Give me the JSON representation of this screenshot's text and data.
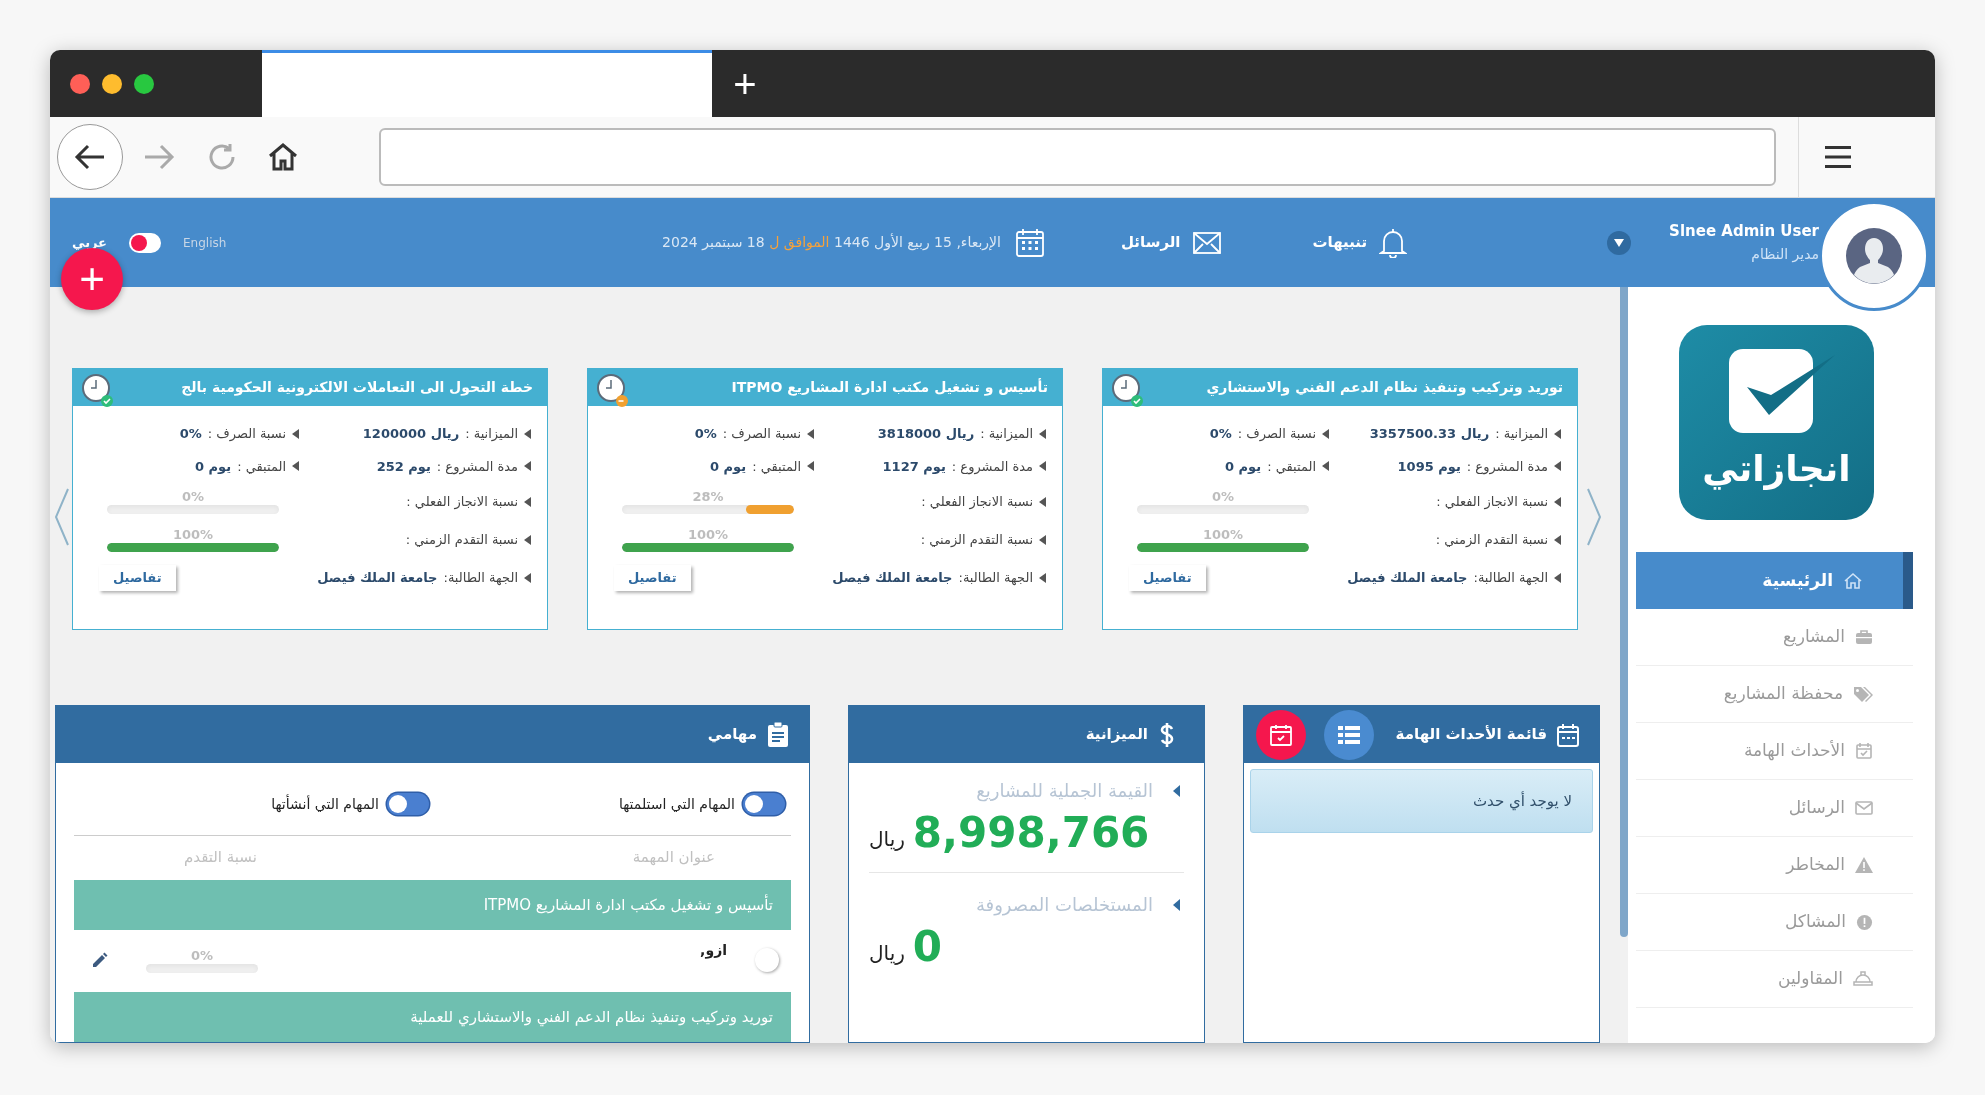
{
  "browser": {
    "new_tab": "+"
  },
  "header": {
    "user_name": "Slnee Admin User",
    "user_role": "مدير النظام",
    "notifications": "تنبيهات",
    "messages": "الرسائل",
    "date_hijri": "الإربعاء, 15 ربيع الأول 1446",
    "date_connector": "الموافق ل",
    "date_gregorian": "18 سبتمبر 2024",
    "languages": [
      {
        "label": "English",
        "selected": false
      },
      {
        "label": "عربي",
        "selected": true
      }
    ],
    "language_switch": {
      "on": false
    },
    "add_button": "+"
  },
  "sidebar": {
    "logo_text": "انجازاتي",
    "items": [
      {
        "label": "الرئيسية",
        "selected": true
      },
      {
        "label": "المشاريع",
        "selected": false
      },
      {
        "label": "محفظة المشاريع",
        "selected": false
      },
      {
        "label": "الأحداث الهامة",
        "selected": false
      },
      {
        "label": "الرسائل",
        "selected": false
      },
      {
        "label": "المخاطر",
        "selected": false
      },
      {
        "label": "المشاكل",
        "selected": false
      },
      {
        "label": "المقاولين",
        "selected": false
      }
    ]
  },
  "project_cards": [
    {
      "title": "توريد وتركيب وتنفيذ نظام الدعم الفني والاستشاري",
      "kind": "done",
      "fields": [
        {
          "label": "الميزانية :",
          "value": "3357500.33 ريال"
        },
        {
          "label": "نسبة الصرف :",
          "value": "0%"
        },
        {
          "label": "مدة المشروع :",
          "value": "1095 يوم"
        },
        {
          "label": "المتبقي :",
          "value": "0 يوم"
        }
      ],
      "progress": [
        {
          "kind": "actual",
          "label": "نسبة الانجاز الفعلي :",
          "reading": "0%",
          "level": 0
        },
        {
          "kind": "time",
          "label": "نسبة التقدم الزمني :",
          "reading": "100%",
          "level": 1
        }
      ],
      "requester": {
        "label": "الجهة الطالبة:",
        "value": "جامعة الملك فيصل"
      },
      "details_button": "تفاصيل"
    },
    {
      "title": "تأسيس و تشغيل مكتب ادارة المشاريع ITPMO",
      "kind": "warning",
      "fields": [
        {
          "label": "الميزانية :",
          "value": "3818000 ريال"
        },
        {
          "label": "نسبة الصرف :",
          "value": "0%"
        },
        {
          "label": "مدة المشروع :",
          "value": "1127 يوم"
        },
        {
          "label": "المتبقي :",
          "value": "0 يوم"
        }
      ],
      "progress": [
        {
          "kind": "actual",
          "label": "نسبة الانجاز الفعلي :",
          "reading": "28%",
          "level": 0.28
        },
        {
          "kind": "time",
          "label": "نسبة التقدم الزمني :",
          "reading": "100%",
          "level": 1
        }
      ],
      "requester": {
        "label": "الجهة الطالبة:",
        "value": "جامعة الملك فيصل"
      },
      "details_button": "تفاصيل"
    },
    {
      "title": "خطة التحول الى التعاملات الالكترونية الحكومية بالج",
      "kind": "done",
      "fields": [
        {
          "label": "الميزانية :",
          "value": "1200000 ريال"
        },
        {
          "label": "نسبة الصرف :",
          "value": "0%"
        },
        {
          "label": "مدة المشروع :",
          "value": "252 يوم"
        },
        {
          "label": "المتبقي :",
          "value": "0 يوم"
        }
      ],
      "progress": [
        {
          "kind": "actual",
          "label": "نسبة الانجاز الفعلي :",
          "reading": "0%",
          "level": 0
        },
        {
          "kind": "time",
          "label": "نسبة التقدم الزمني :",
          "reading": "100%",
          "level": 1
        }
      ],
      "requester": {
        "label": "الجهة الطالبة:",
        "value": "جامعة الملك فيصل"
      },
      "details_button": "تفاصيل"
    }
  ],
  "events_panel": {
    "title": "قائمة الأحداث الهامة",
    "empty_message": "لا يوجد أي حدث"
  },
  "budget_panel": {
    "title": "الميزانية",
    "items": [
      {
        "label": "القيمة الجملية للمشاريع",
        "value": "8,998,766",
        "unit": "ريال"
      },
      {
        "label": "المستخلصات المصروفة",
        "value": "0",
        "unit": "ريال"
      }
    ]
  },
  "tasks_panel": {
    "title": "مهامي",
    "toggles": [
      {
        "label": "المهام التي استلمتها",
        "on": false
      },
      {
        "label": "المهام التي أنشأتها",
        "on": false
      }
    ],
    "columns": [
      "عنوان المهمة",
      "نسبة التقدم"
    ],
    "groups": [
      {
        "title": "تأسيس و تشغيل مكتب ادارة المشاريع ITPMO",
        "tasks": [
          {
            "title": "ازو,",
            "checked": false,
            "reading": "0%",
            "level": 0
          }
        ]
      },
      {
        "title": "توريد وتركيب وتنفيذ نظام الدعم الفني والاستشاري للعملية"
      }
    ]
  }
}
